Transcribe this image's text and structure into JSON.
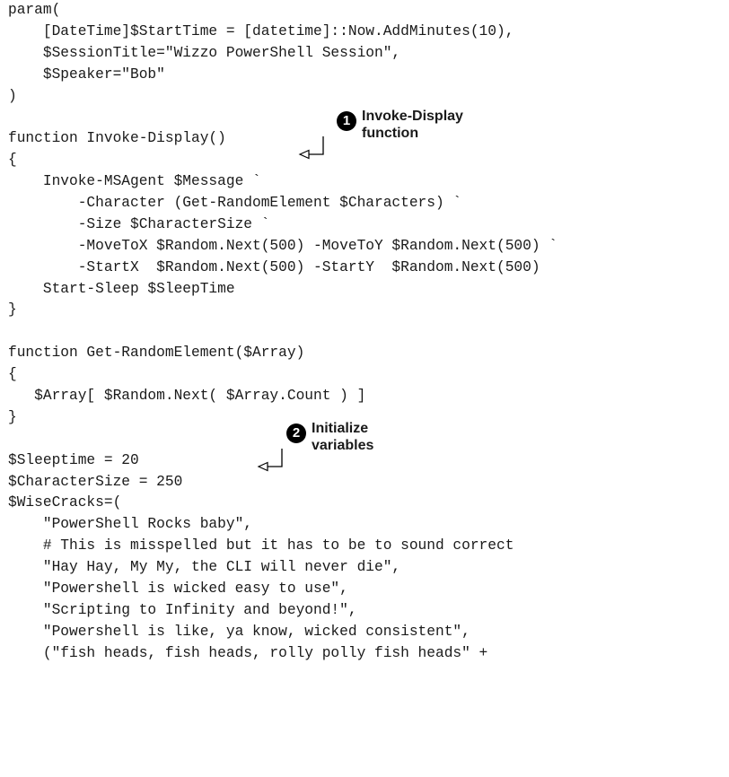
{
  "code_lines": [
    "param(",
    "    [DateTime]$StartTime = [datetime]::Now.AddMinutes(10),",
    "    $SessionTitle=\"Wizzo PowerShell Session\",",
    "    $Speaker=\"Bob\"",
    ")",
    "",
    "function Invoke-Display()",
    "{",
    "    Invoke-MSAgent $Message `",
    "        -Character (Get-RandomElement $Characters) `",
    "        -Size $CharacterSize `",
    "        -MoveToX $Random.Next(500) -MoveToY $Random.Next(500) `",
    "        -StartX  $Random.Next(500) -StartY  $Random.Next(500)",
    "    Start-Sleep $SleepTime",
    "}",
    "",
    "function Get-RandomElement($Array)",
    "{",
    "   $Array[ $Random.Next( $Array.Count ) ]",
    "}",
    "",
    "$Sleeptime = 20",
    "$CharacterSize = 250",
    "$WiseCracks=(",
    "    \"PowerShell Rocks baby\",",
    "    # This is misspelled but it has to be to sound correct",
    "    \"Hay Hay, My My, the CLI will never die\",",
    "    \"Powershell is wicked easy to use\",",
    "    \"Scripting to Infinity and beyond!\",",
    "    \"Powershell is like, ya know, wicked consistent\",",
    "    (\"fish heads, fish heads, rolly polly fish heads\" +"
  ],
  "callouts": [
    {
      "number": "1",
      "line1": "Invoke-Display",
      "line2": "function"
    },
    {
      "number": "2",
      "line1": "Initialize",
      "line2": "variables"
    }
  ]
}
